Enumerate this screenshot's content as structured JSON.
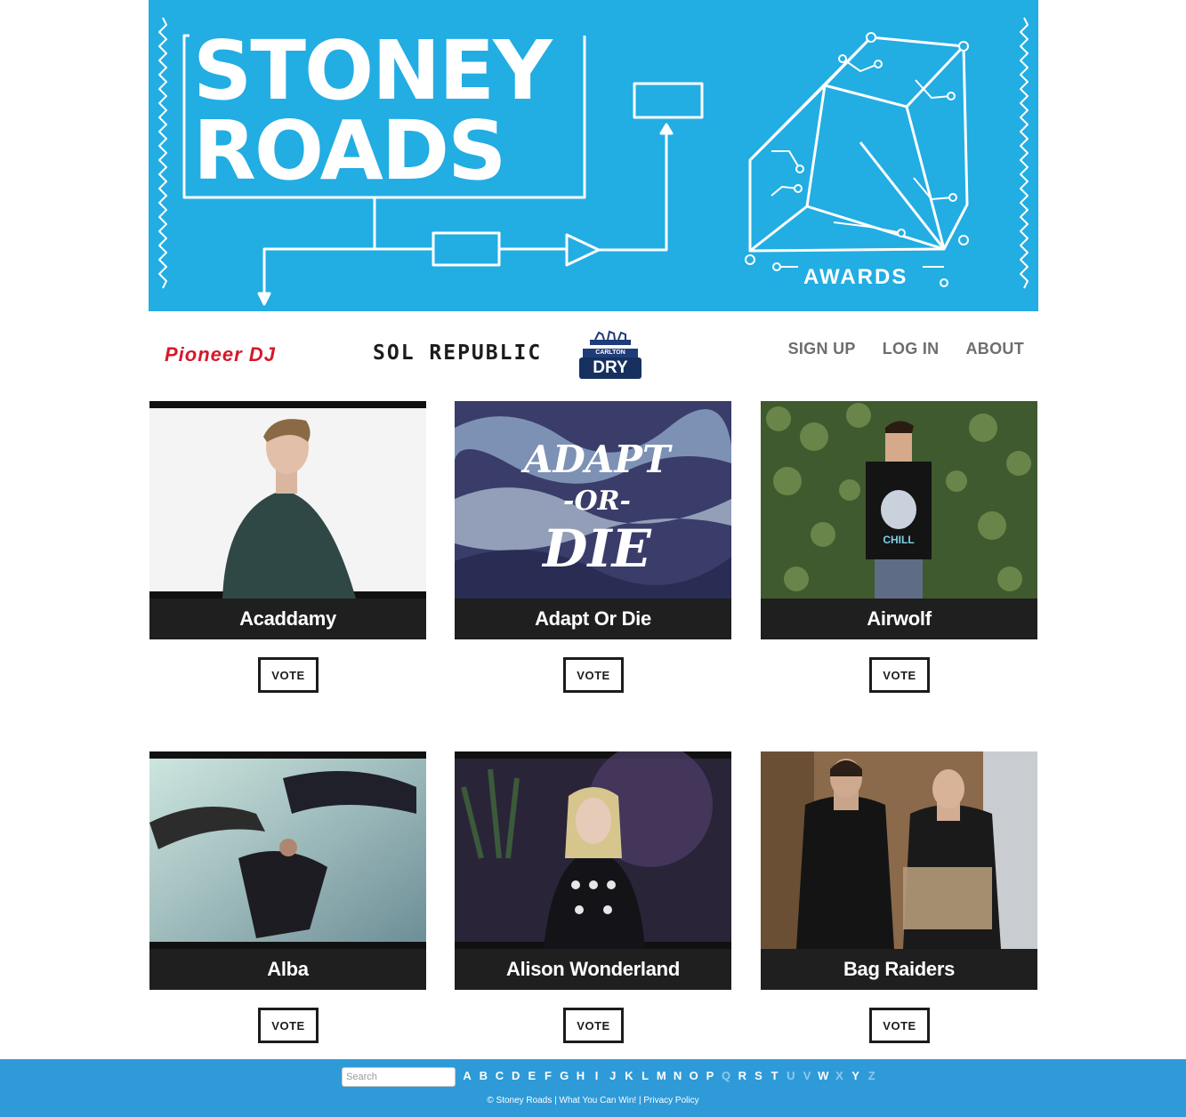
{
  "banner": {
    "title_line1": "STONEY",
    "title_line2": "ROADS",
    "awards_label": "AWARDS"
  },
  "sponsors": {
    "pioneer": "Pioneer DJ",
    "sol_republic": "SOL REPUBLIC",
    "carlton_top": "CARLTON",
    "carlton_main": "DRY"
  },
  "nav": {
    "sign_up": "SIGN UP",
    "log_in": "LOG IN",
    "about": "ABOUT"
  },
  "vote_label": "VOTE",
  "artists": [
    {
      "name": "Acaddamy"
    },
    {
      "name": "Adapt Or Die",
      "art_text": [
        "ADAPT",
        "-OR-",
        "DIE"
      ]
    },
    {
      "name": "Airwolf",
      "shirt_text": "CHILL"
    },
    {
      "name": "Alba"
    },
    {
      "name": "Alison Wonderland"
    },
    {
      "name": "Bag Raiders"
    }
  ],
  "footer": {
    "search_placeholder": "Search",
    "letters": [
      {
        "l": "A",
        "active": true
      },
      {
        "l": "B",
        "active": true
      },
      {
        "l": "C",
        "active": true
      },
      {
        "l": "D",
        "active": true
      },
      {
        "l": "E",
        "active": true
      },
      {
        "l": "F",
        "active": true
      },
      {
        "l": "G",
        "active": true
      },
      {
        "l": "H",
        "active": true
      },
      {
        "l": "I",
        "active": true
      },
      {
        "l": "J",
        "active": true
      },
      {
        "l": "K",
        "active": true
      },
      {
        "l": "L",
        "active": true
      },
      {
        "l": "M",
        "active": true
      },
      {
        "l": "N",
        "active": true
      },
      {
        "l": "O",
        "active": true
      },
      {
        "l": "P",
        "active": true
      },
      {
        "l": "Q",
        "active": false
      },
      {
        "l": "R",
        "active": true
      },
      {
        "l": "S",
        "active": true
      },
      {
        "l": "T",
        "active": true
      },
      {
        "l": "U",
        "active": false
      },
      {
        "l": "V",
        "active": false
      },
      {
        "l": "W",
        "active": true
      },
      {
        "l": "X",
        "active": false
      },
      {
        "l": "Y",
        "active": true
      },
      {
        "l": "Z",
        "active": false
      }
    ],
    "copyright": "© Stoney Roads",
    "link_win": "What You Can Win!",
    "link_privacy": "Privacy Policy",
    "separator": " | "
  },
  "colors": {
    "banner_blue": "#22ade3",
    "footer_blue": "#2f9ad8",
    "caption_bg": "#1f1f1f",
    "pioneer_red": "#d5182a"
  }
}
